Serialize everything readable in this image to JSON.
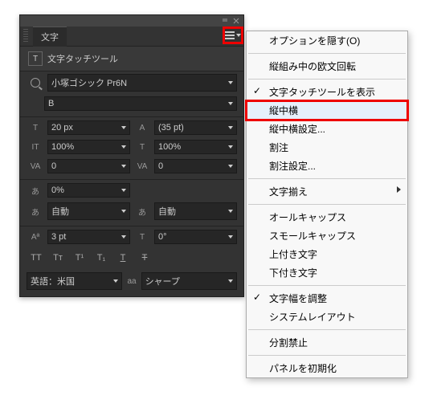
{
  "panel": {
    "title_tab": "文字",
    "touch_tool": "文字タッチツール",
    "font_family": "小塚ゴシック Pr6N",
    "font_style": "B",
    "font_size": "20 px",
    "leading": "(35 pt)",
    "vscale": "100%",
    "hscale": "100%",
    "kerning": "0",
    "tracking": "0",
    "propw": "0%",
    "aki_l": "自動",
    "aki_r": "自動",
    "baseline": "3 pt",
    "rotation": "0°",
    "lang_label": "英語：米国",
    "aa_prefix": "aa",
    "aa_label": "シャープ"
  },
  "menu": {
    "hide_options": "オプションを隠す(O)",
    "vert_latin_rotate": "縦組み中の欧文回転",
    "show_touch_tool": "文字タッチツールを表示",
    "tcy": "縦中横",
    "tcy_settings": "縦中横設定...",
    "warichu": "割注",
    "warichu_settings": "割注設定...",
    "moji_soroe": "文字揃え",
    "all_caps": "オールキャップス",
    "small_caps": "スモールキャップス",
    "superscript": "上付き文字",
    "subscript": "下付き文字",
    "adjust_width": "文字幅を調整",
    "system_layout": "システムレイアウト",
    "no_break": "分割禁止",
    "reset_panel": "パネルを初期化"
  }
}
